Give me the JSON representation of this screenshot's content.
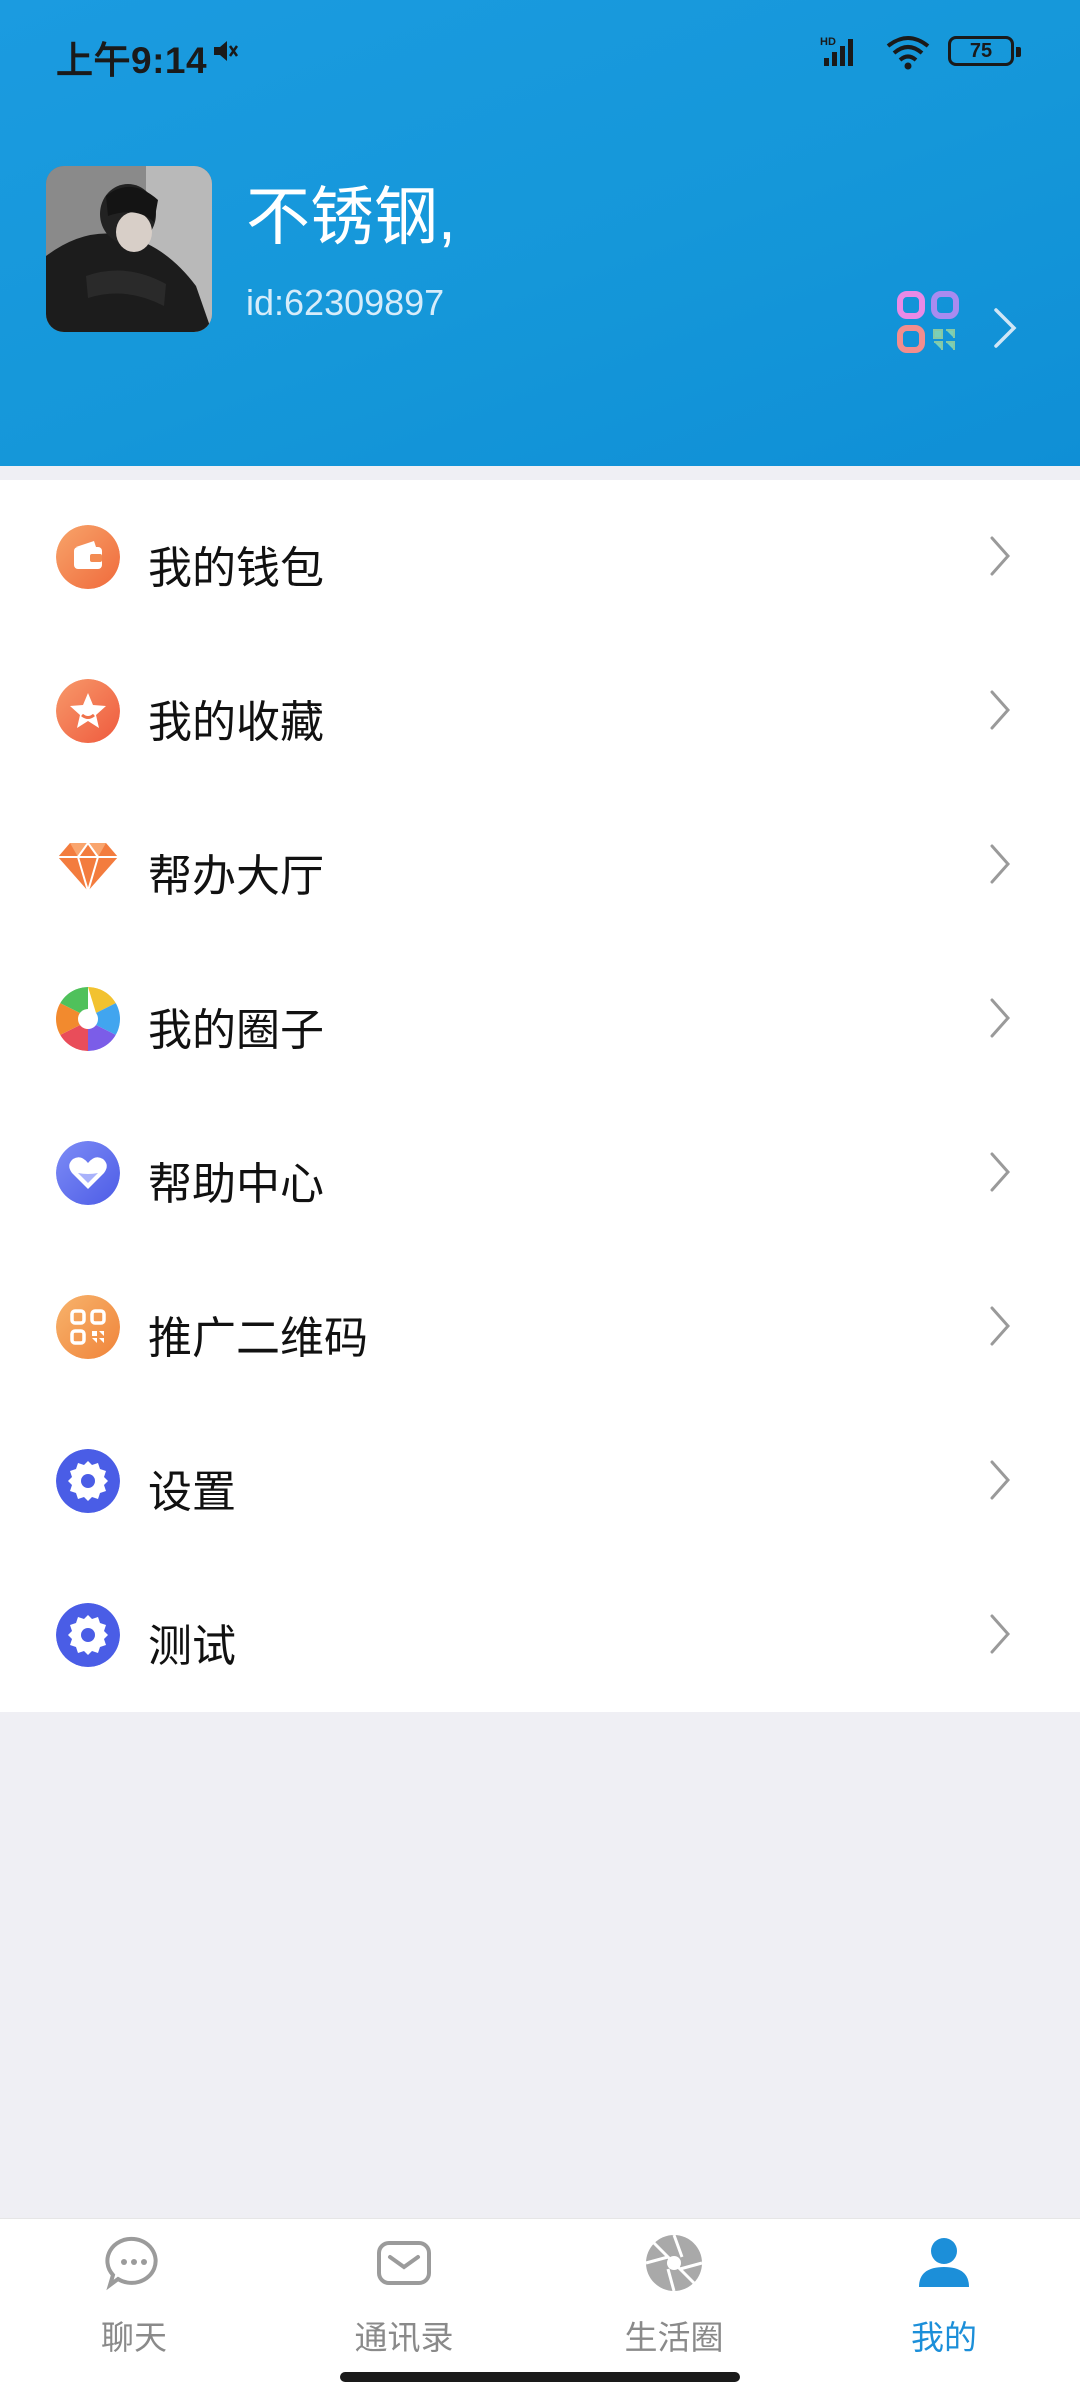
{
  "status": {
    "time": "上午9:14",
    "battery": "75",
    "signal_label": "HD"
  },
  "profile": {
    "name": "不锈钢,",
    "id": "id:62309897"
  },
  "menu": [
    {
      "label": "我的钱包",
      "icon": "wallet-icon"
    },
    {
      "label": "我的收藏",
      "icon": "star-icon"
    },
    {
      "label": "帮办大厅",
      "icon": "diamond-icon"
    },
    {
      "label": "我的圈子",
      "icon": "aperture-icon"
    },
    {
      "label": "帮助中心",
      "icon": "heart-icon"
    },
    {
      "label": "推广二维码",
      "icon": "qr-code-icon"
    },
    {
      "label": "设置",
      "icon": "gear-icon"
    },
    {
      "label": "测试",
      "icon": "gear-icon"
    }
  ],
  "tabs": [
    {
      "label": "聊天",
      "icon": "chat-icon"
    },
    {
      "label": "通讯录",
      "icon": "contacts-icon"
    },
    {
      "label": "生活圈",
      "icon": "aperture-icon"
    },
    {
      "label": "我的",
      "icon": "person-icon",
      "active": true
    }
  ],
  "colors": {
    "header": "#1597d9",
    "accent": "#1c8fd9",
    "background": "#efeff4"
  }
}
